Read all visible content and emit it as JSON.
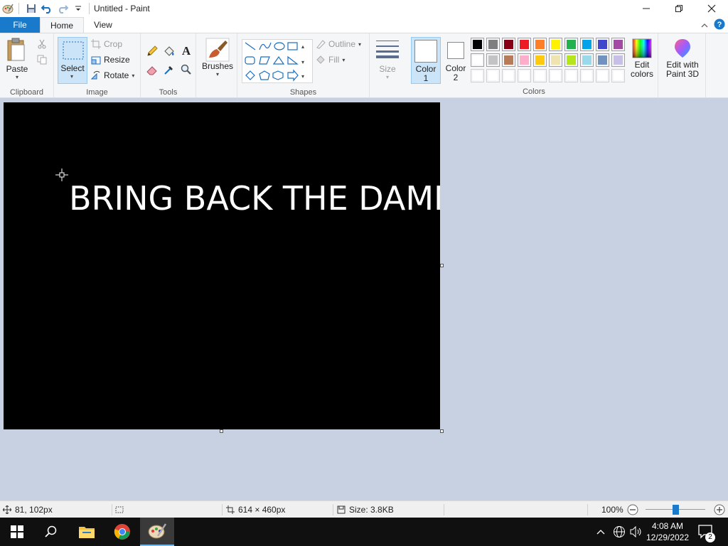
{
  "window": {
    "title": "Untitled - Paint"
  },
  "tabs": {
    "file": "File",
    "home": "Home",
    "view": "View"
  },
  "ribbon": {
    "clipboard": {
      "label": "Clipboard",
      "paste": "Paste"
    },
    "image": {
      "label": "Image",
      "select": "Select",
      "crop": "Crop",
      "resize": "Resize",
      "rotate": "Rotate"
    },
    "tools": {
      "label": "Tools"
    },
    "brushes": {
      "label": "Brushes"
    },
    "shapes": {
      "label": "Shapes",
      "outline": "Outline",
      "fill": "Fill"
    },
    "size": {
      "label": "Size"
    },
    "colors": {
      "label": "Colors",
      "color1": "Color 1",
      "color1_line1": "Color",
      "color1_line2": "1",
      "color2_line1": "Color",
      "color2_line2": "2",
      "edit_colors_line1": "Edit",
      "edit_colors_line2": "colors",
      "palette_row1": [
        "#000000",
        "#7f7f7f",
        "#880015",
        "#ed1c24",
        "#ff7f27",
        "#fff200",
        "#22b14c",
        "#00a2e8",
        "#3f48cc",
        "#a349a4"
      ],
      "palette_row2": [
        "#ffffff",
        "#c3c3c3",
        "#b97a57",
        "#ffaec9",
        "#ffc90e",
        "#efe4b0",
        "#b5e61d",
        "#99d9ea",
        "#7092be",
        "#c8bfe7"
      ],
      "palette_row3": [
        "#ffffff",
        "#ffffff",
        "#ffffff",
        "#ffffff",
        "#ffffff",
        "#ffffff",
        "#ffffff",
        "#ffffff",
        "#ffffff",
        "#ffffff"
      ],
      "color1_value": "#ffffff",
      "color2_value": "#ffffff"
    },
    "paint3d": {
      "line1": "Edit with",
      "line2": "Paint 3D"
    }
  },
  "canvas": {
    "text": "BRING BACK THE DAMN",
    "background": "#000000",
    "text_color": "#ffffff"
  },
  "status": {
    "cursor_pos": "81, 102px",
    "image_size": "614 × 460px",
    "file_size": "Size: 3.8KB",
    "zoom": "100%"
  },
  "taskbar": {
    "time": "4:08 AM",
    "date": "12/29/2022",
    "notification_count": "2"
  }
}
